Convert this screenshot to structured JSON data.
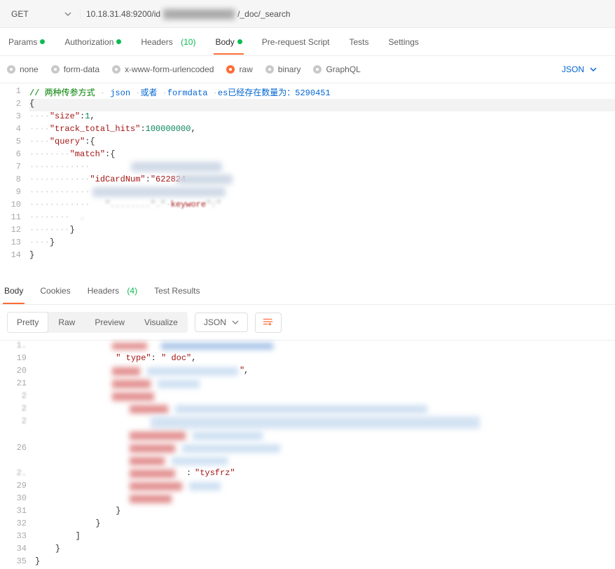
{
  "request": {
    "method": "GET",
    "url_left": "10.18.31.48:9200/id",
    "url_right": "/_doc/_search"
  },
  "tabs": {
    "params": {
      "label": "Params",
      "dot": true
    },
    "auth": {
      "label": "Authorization",
      "dot": true
    },
    "headers": {
      "label": "Headers",
      "count": "(10)"
    },
    "body": {
      "label": "Body",
      "dot": true,
      "active": true
    },
    "prereq": {
      "label": "Pre-request Script"
    },
    "tests": {
      "label": "Tests"
    },
    "settings": {
      "label": "Settings"
    }
  },
  "bodytype": {
    "none": "none",
    "form": "form-data",
    "urlenc": "x-www-form-urlencoded",
    "raw": "raw",
    "binary": "binary",
    "graphql": "GraphQL",
    "language": "JSON"
  },
  "editor": {
    "comment_prefix": "// 两种传参方式",
    "comment_json": "json",
    "comment_or": "或者",
    "comment_formdata": "formdata",
    "comment_tail": "es已经存在数量为：5290451",
    "size_key": "\"size\"",
    "size_val": "1",
    "tth_key": "\"track_total_hits\"",
    "tth_val": "100000000",
    "query_key": "\"query\"",
    "match_key": "\"match\"",
    "idcard_key": "\"idCardNum\"",
    "idcard_val": "\"622824",
    "kw_hint": "keywore"
  },
  "resp_tabs": {
    "body": "Body",
    "cookies": "Cookies",
    "headers": "Headers",
    "headers_count": "(4)",
    "tests": "Test Results"
  },
  "resp_toolbar": {
    "pretty": "Pretty",
    "raw": "Raw",
    "preview": "Preview",
    "visualize": "Visualize",
    "lang": "JSON"
  },
  "resp": {
    "type_key": "\" type\"",
    "type_val": "\" doc\"",
    "tysfrz": "\"tysfrz\""
  }
}
